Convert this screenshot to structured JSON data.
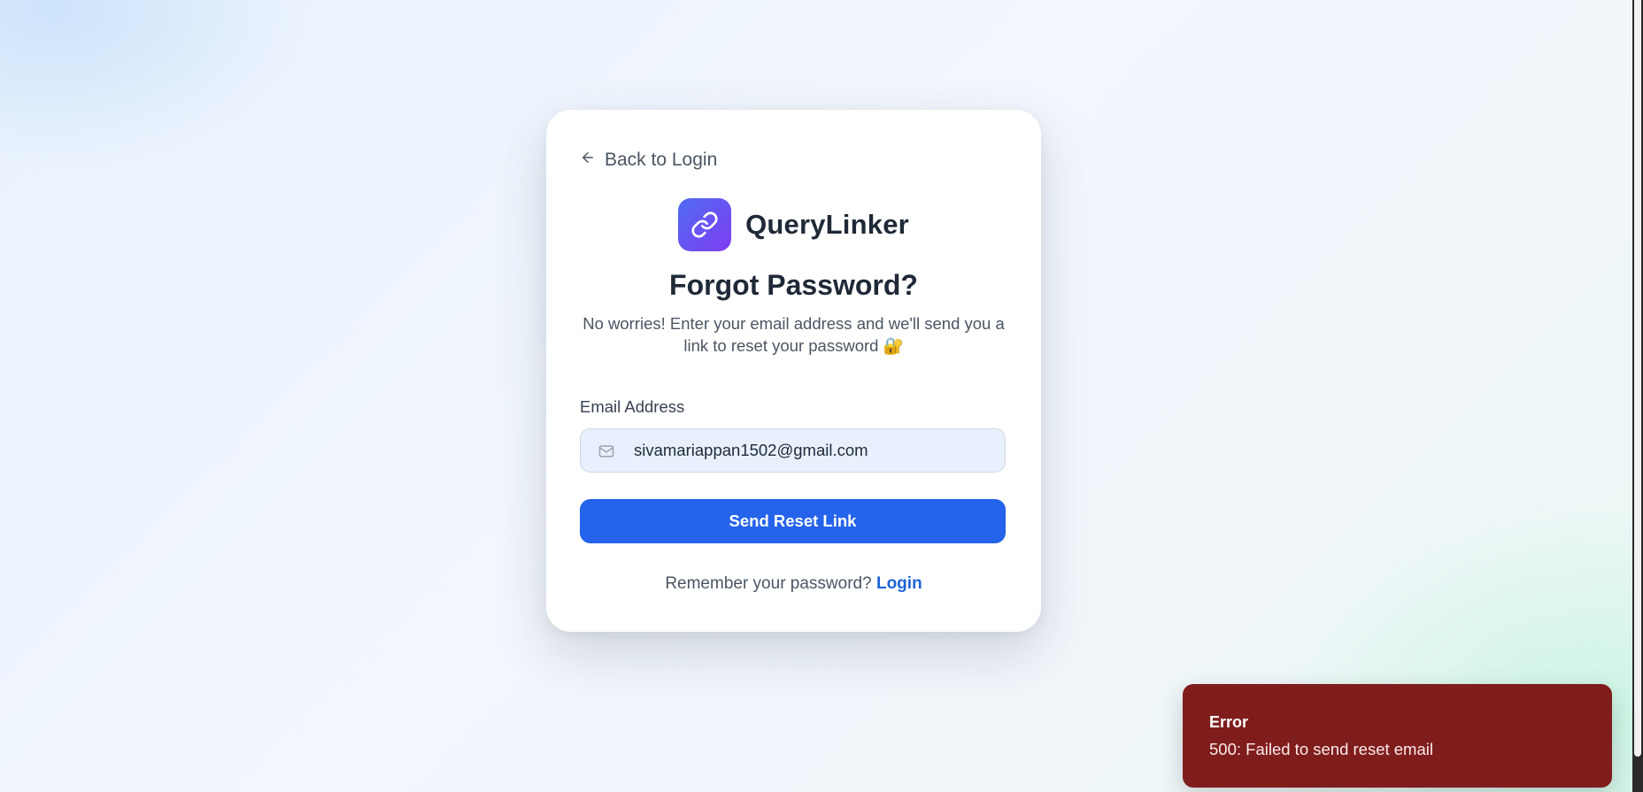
{
  "back_link": {
    "label": "Back to Login"
  },
  "brand": {
    "name": "QueryLinker",
    "icon": "link-icon"
  },
  "heading": "Forgot Password?",
  "subtitle": "No worries! Enter your email address and we'll send you a link to reset your password 🔐",
  "form": {
    "email_label": "Email Address",
    "email_value": "sivamariappan1502@gmail.com",
    "email_icon": "mail-icon",
    "submit_label": "Send Reset Link"
  },
  "footer": {
    "prompt": "Remember your password?",
    "link_label": "Login"
  },
  "toast": {
    "title": "Error",
    "message": "500: Failed to send reset email"
  },
  "colors": {
    "primary": "#2563eb",
    "brand_gradient_start": "#4f6cf5",
    "brand_gradient_end": "#7e3cf0",
    "error": "#7f1d1d"
  }
}
